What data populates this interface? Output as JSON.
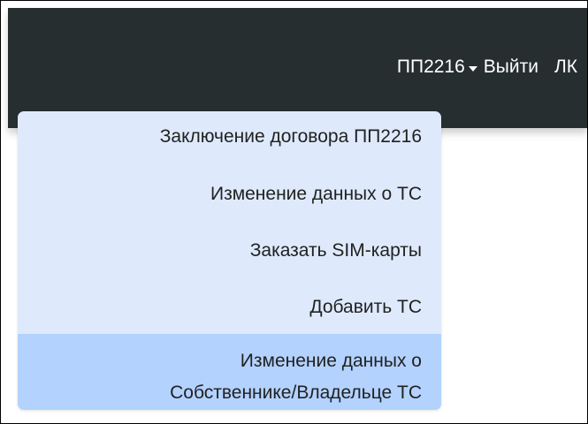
{
  "navbar": {
    "dropdown_label": "ПП2216",
    "logout_label": "Выйти",
    "lk_label": "ЛК",
    "background_color": "#262e2f"
  },
  "dropdown": {
    "background_color": "#deeafc",
    "active_color": "#b3d2fe",
    "items": [
      {
        "label": "Заключение договора ПП2216"
      },
      {
        "label": "Изменение данных о ТС"
      },
      {
        "label": "Заказать SIM-карты"
      },
      {
        "label": "Добавить ТС"
      }
    ],
    "active_item": {
      "line1": "Изменение данных о",
      "line2": "Собственнике/Владельце ТС"
    }
  }
}
